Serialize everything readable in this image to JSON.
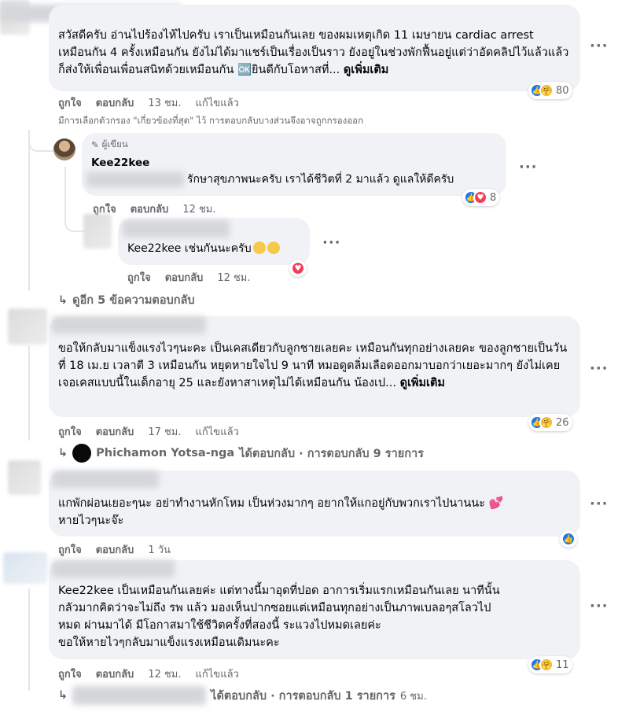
{
  "comments": [
    {
      "text": "สวัสดีครับ อ่านไปร้องไห้ไปครับ เราเป็นเหมือนกันเลย ของผมเหตุเกิด 11 เมษายน cardiac arrest เหมือนกัน 4 ครั้งเหมือนกัน ยังไม่ได้มาแชร์เป็นเรื่องเป็นราว ยังอยู่ในช่วงพักฟื้นอยู่แต่ว่าอัดคลิปไว้แล้วแล้วก็ส่งให้เพื่อนเพื่อนสนิทด้วยเหมือนกัน 🆗ยินดีกับโอหาสที่...",
      "see_more": "ดูเพิ่มเติม",
      "like": "ถูกใจ",
      "reply": "ตอบกลับ",
      "time": "13 ชม.",
      "edited": "แก้ไขแล้ว",
      "reaction_count": "80"
    },
    {
      "text": "ขอให้กลับมาแข็งแรงไวๆนะคะ เป็นเคสเดียวกับลูกชายเลยคะ เหมือนกันทุกอย่างเลยคะ ของลูกชายเป็นวันที่ 18 เม.ย เวลาตี 3 เหมือนกัน หยุดหายใจไป 9 นาที หมอดูดลิ่มเลือดออกมาบอกว่าเยอะมากๆ ยังไม่เคยเจอเคสแบบนี้ในเด็กอายุ 25 และยังหาสาเหตุไม่ได้เหมือนกัน น้องเป...",
      "see_more": "ดูเพิ่มเติม",
      "like": "ถูกใจ",
      "reply": "ตอบกลับ",
      "time": "17 ชม.",
      "edited": "แก้ไขแล้ว",
      "reaction_count": "26"
    },
    {
      "text_line1": "แกพักผ่อนเยอะๆนะ อย่าทำงานหักโหม เป็นห่วงมากๆ อยากให้แกอยู่กับพวกเราไปนานนะ",
      "text_line2": "หายไวๆนะจ๊ะ",
      "like": "ถูกใจ",
      "reply": "ตอบกลับ",
      "time": "1 วัน"
    },
    {
      "text_line1": "Kee22kee เป็นเหมือนกันเลยค่ะ แต่ทางนี้มาอุดที่ปอด อาการเริ่มแรกเหมือนกันเลย นาทีนั้น",
      "text_line2": "กลัวมากคิดว่าจะไม่ถึง รพ แล้ว มองเห็นปากซอยแต่เหมือนทุกอย่างเป็นภาพเบลอๆสโลวไป",
      "text_line3": "หมด ผ่านมาได้ มีโอกาสมาใช้ชีวิตครั้งที่สองนี้ ระแวงไปหมดเลยค่ะ",
      "text_line4": "ขอให้หายไวๆกลับมาแข็งแรงเหมือนเดิมนะคะ",
      "like": "ถูกใจ",
      "reply": "ตอบกลับ",
      "time": "12 ชม.",
      "edited": "แก้ไขแล้ว",
      "reaction_count": "11"
    }
  ],
  "filter_note": "มีการเลือกตัวกรอง \"เกี่ยวข้องที่สุด\" ไว้ การตอบกลับบางส่วนจึงอาจถูกกรองออก",
  "replies": [
    {
      "author_tag": "ผู้เขียน",
      "name": "Kee22kee",
      "text": "รักษาสุขภาพนะครับ เราได้ชีวิตที่ 2 มาแล้ว ดูแลให้ดีครับ",
      "like": "ถูกใจ",
      "reply": "ตอบกลับ",
      "time": "12 ชม.",
      "reaction_count": "8"
    },
    {
      "text": "Kee22kee เช่นกันนะครับ",
      "like": "ถูกใจ",
      "reply": "ตอบกลับ",
      "time": "12 ชม."
    }
  ],
  "view_more_replies": "ดูอีก 5 ข้อความตอบกลับ",
  "replied_1": {
    "name": "Phichamon Yotsa-nga",
    "suffix": "ได้ตอบกลับ · การตอบกลับ 9 รายการ"
  },
  "replied_2": {
    "suffix": "ได้ตอบกลับ · การตอบกลับ 1 รายการ",
    "time": "6 ชม."
  },
  "colors": {
    "like": "#1877f2",
    "love": "#f33e58",
    "care": "#f7b928",
    "bubble": "#f0f2f5",
    "meta": "#65676b"
  }
}
